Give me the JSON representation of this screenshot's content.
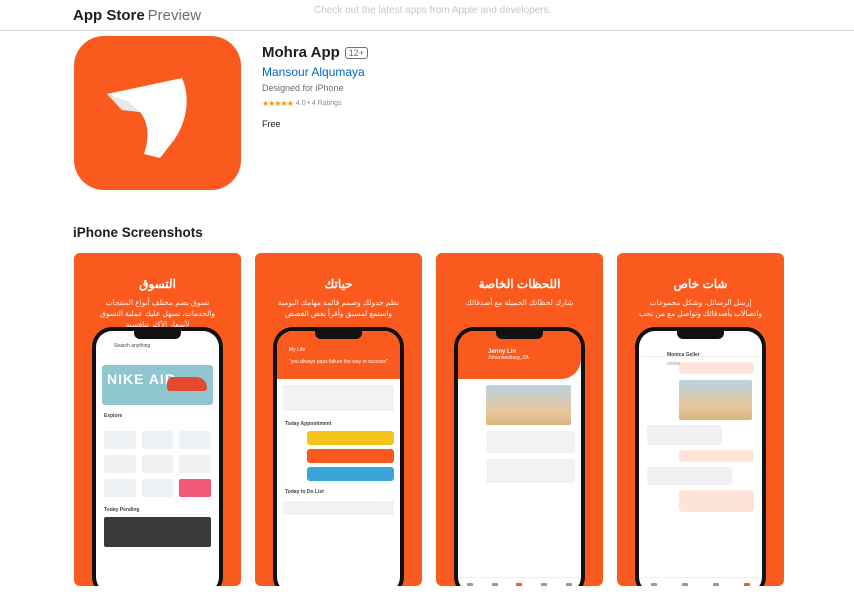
{
  "header": {
    "brand": "App Store",
    "brand_suffix": "Preview",
    "banner": "Check out the latest apps from Apple and developers."
  },
  "app": {
    "name": "Mohra App",
    "age_rating": "12+",
    "developer": "Mansour Alqumaya",
    "designed_for": "Designed for iPhone",
    "stars": "★★★★★",
    "rating_text": "4.0 • 4 Ratings",
    "price": "Free",
    "icon_color": "#fb5a1e"
  },
  "screenshots": {
    "section_title": "iPhone Screenshots",
    "items": [
      {
        "title": "التسوق",
        "subtitle": "تسوق يضم مختلف أنواع المنتجات والخدمات، تسهل عليك عملية التسوق لأسعار الأكثر تنافسية"
      },
      {
        "title": "حياتك",
        "subtitle": "نظم جدولك وصمم قائمة مهامك اليومية واستمع لمسبق وأقرأ بعض القصص"
      },
      {
        "title": "اللحظات الخاصة",
        "subtitle": "شارك لحظاتك الجميلة مع أصدقائك"
      },
      {
        "title": "شات خاص",
        "subtitle": "إرسل الرسائل، وشكل مجموعات واتصالات بأصدقائك وتواصل مع من تحب"
      }
    ],
    "shot1": {
      "search": "Search anything",
      "hero": "NIKE AIR",
      "explore": "Explore",
      "today": "Today Pending"
    },
    "shot2": {
      "title": "My Life",
      "quote": "\"you always pass failure the way to success\"",
      "today": "Today Appointment",
      "todo": "Today to Do List"
    },
    "shot3": {
      "name": "Jenny Lin",
      "place": "Johannesburg, ZA"
    },
    "shot4": {
      "contact": "Monica Geller",
      "status": "online"
    }
  }
}
